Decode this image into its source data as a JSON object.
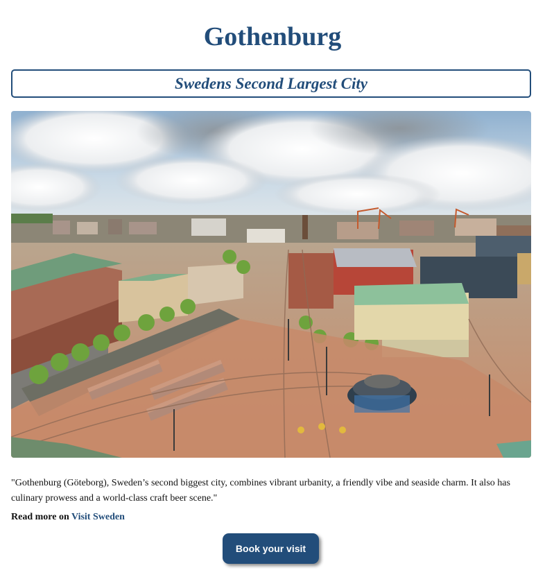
{
  "page": {
    "title": "Gothenburg",
    "subtitle": "Swedens Second Largest City"
  },
  "hero_image": {
    "alt": "Gothenburg"
  },
  "quote": {
    "text": "\"Gothenburg (Göteborg), Sweden’s second biggest city, combines vibrant urbanity, a friendly vibe and seaside charm. It also has culinary prowess and a world-class craft beer scene.\""
  },
  "read_more": {
    "prefix": "Read more on",
    "link_text": "Visit Sweden"
  },
  "cta": {
    "label": "Book your visit"
  },
  "colors": {
    "accent": "#224d7a",
    "button_text": "#ffffff"
  }
}
